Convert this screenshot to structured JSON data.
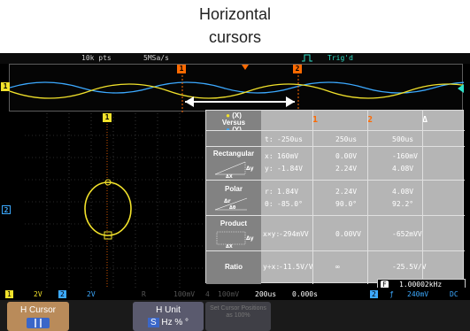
{
  "caption": {
    "line1": "Horizontal",
    "line2": "cursors"
  },
  "topbar": {
    "pts": "10k pts",
    "rate": "5MSa/s",
    "trig": "Trig'd"
  },
  "overview": {
    "ch_marker": "1",
    "cursor1": "1",
    "cursor2": "2"
  },
  "left": {
    "ch2_marker": "2",
    "cursor_marker": "1"
  },
  "table": {
    "header": {
      "versus_x": "(X)",
      "versus_label": "Versus",
      "versus_y": "(Y)",
      "col1": "1",
      "col2": "2",
      "col3": "Δ"
    },
    "time_row": {
      "prefix": "t:",
      "c1": "-250us",
      "c2": "250us",
      "c3": "500us"
    },
    "rect": {
      "label": "Rectangular",
      "x_prefix": "x:",
      "y_prefix": "y:",
      "x1": "160mV",
      "x2": "0.00V",
      "x3": "-160mV",
      "y1": "-1.84V",
      "y2": "2.24V",
      "y3": "4.08V",
      "axis_y": "Δy",
      "axis_x": "ΔX"
    },
    "polar": {
      "label": "Polar",
      "r_prefix": "r:",
      "t_prefix": "θ:",
      "r1": "1.84V",
      "r2": "2.24V",
      "r3": "4.08V",
      "t1": "-85.0°",
      "t2": "90.0°",
      "t3": "92.2°",
      "axis1": "Δr",
      "axis2": "Δθ"
    },
    "product": {
      "label": "Product",
      "prefix": "x×y:",
      "v1": "-294mVV",
      "v2": "0.00VV",
      "v3": "-652mVV",
      "axis_y": "Δy",
      "axis_x": "ΔX"
    },
    "ratio": {
      "label": "Ratio",
      "prefix": "y÷x:",
      "v1": "-11.5V/V",
      "v2": "∞",
      "v3": "-25.5V/V"
    }
  },
  "statusbar": {
    "ch1": "1",
    "ch1_val": "2V",
    "ch2": "2",
    "ch2_val": "2V",
    "ch3": "R",
    "ch3_val": "100mV",
    "ch4": "4",
    "ch4_val": "100mV",
    "timebase": "200us",
    "pos": "0.000s",
    "trig_ch": "2",
    "trig_slope": "ƒ",
    "trig_level": "240mV",
    "coupling": "DC"
  },
  "freq": {
    "icon": "F",
    "value": "1.00002kHz"
  },
  "softkeys": {
    "h_cursor": "H Cursor",
    "h_unit": "H Unit",
    "h_unit_sel": "S",
    "h_unit_opts": "Hz % °",
    "third": "Set Cursor Positions as 100%"
  },
  "colors": {
    "ch1": "#f2e22b",
    "ch2": "#3ca9ff",
    "cursor": "#ff6a00",
    "trig": "#2ee0c8"
  }
}
